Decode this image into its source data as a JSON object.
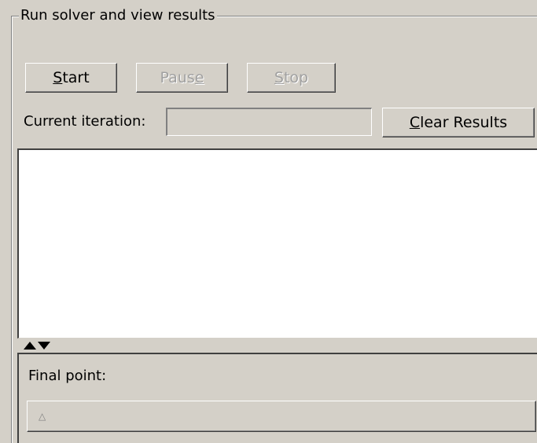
{
  "group": {
    "title": "Run solver and view results"
  },
  "buttons": {
    "start": {
      "mnemonic": "S",
      "rest": "tart"
    },
    "pause": {
      "before": "Paus",
      "mnemonic": "e",
      "after": ""
    },
    "stop": {
      "mnemonic": "S",
      "rest": "top"
    },
    "clear": {
      "mnemonic": "C",
      "rest": "lear Results"
    }
  },
  "iteration": {
    "label": "Current iteration:",
    "value": ""
  },
  "results": {
    "text": ""
  },
  "final_point": {
    "label": "Final point:",
    "sort_icon": "sort-ascending-icon",
    "sort_glyph": "△"
  }
}
